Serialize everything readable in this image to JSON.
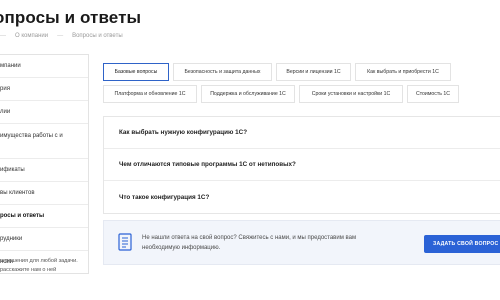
{
  "page": {
    "title": "опросы и ответы"
  },
  "breadcrumb": {
    "items": [
      "О компании",
      "Вопросы и ответы"
    ]
  },
  "sidebar": {
    "items": [
      {
        "label": "мпании"
      },
      {
        "label": "рия"
      },
      {
        "label": "лии"
      },
      {
        "label": "имущества работы с\nи"
      },
      {
        "label": "ификаты"
      },
      {
        "label": "вы клиентов"
      },
      {
        "label": "росы и ответы"
      },
      {
        "label": "рудники"
      },
      {
        "label": "нсии"
      }
    ],
    "note": "м решения для любой задачи.\nрасскажите нам о ней"
  },
  "tabs": {
    "row1": [
      "Базовые вопросы",
      "Безопасность и защита данных",
      "Версии и лицензии 1С",
      "Как выбрать и приобрести 1С"
    ],
    "row2": [
      "Платформа и обновление 1С",
      "Поддержка и обслуживание 1С",
      "Сроки установки и настройки 1С",
      "Стоимость 1С"
    ]
  },
  "faq": {
    "items": [
      "Как выбрать нужную конфигурацию 1С?",
      "Чем отличаются типовые программы 1С от нетиповых?",
      "Что такое конфигурация 1С?"
    ]
  },
  "cta": {
    "text": "Не нашли ответа на свой вопрос? Свяжитесь с нами, и мы предоставим вам необходимую информацию.",
    "button": "ЗАДАТЬ СВОЙ ВОПРОС"
  },
  "colors": {
    "accent": "#2b62d6",
    "cta_bg": "#f2f5fb"
  },
  "icons": {
    "cta": "document-icon"
  }
}
